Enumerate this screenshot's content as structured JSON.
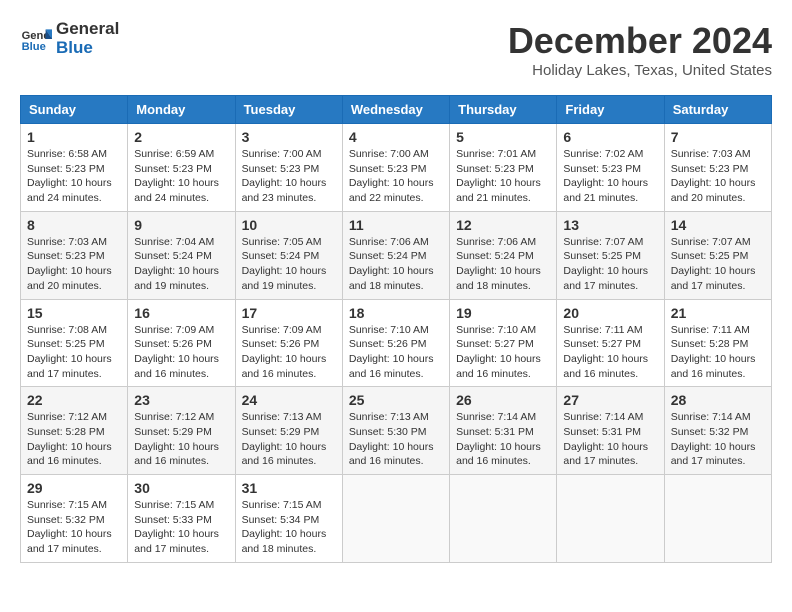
{
  "logo": {
    "line1": "General",
    "line2": "Blue"
  },
  "title": "December 2024",
  "location": "Holiday Lakes, Texas, United States",
  "days_of_week": [
    "Sunday",
    "Monday",
    "Tuesday",
    "Wednesday",
    "Thursday",
    "Friday",
    "Saturday"
  ],
  "weeks": [
    [
      {
        "day": "1",
        "sunrise": "6:58 AM",
        "sunset": "5:23 PM",
        "daylight": "10 hours and 24 minutes."
      },
      {
        "day": "2",
        "sunrise": "6:59 AM",
        "sunset": "5:23 PM",
        "daylight": "10 hours and 24 minutes."
      },
      {
        "day": "3",
        "sunrise": "7:00 AM",
        "sunset": "5:23 PM",
        "daylight": "10 hours and 23 minutes."
      },
      {
        "day": "4",
        "sunrise": "7:00 AM",
        "sunset": "5:23 PM",
        "daylight": "10 hours and 22 minutes."
      },
      {
        "day": "5",
        "sunrise": "7:01 AM",
        "sunset": "5:23 PM",
        "daylight": "10 hours and 21 minutes."
      },
      {
        "day": "6",
        "sunrise": "7:02 AM",
        "sunset": "5:23 PM",
        "daylight": "10 hours and 21 minutes."
      },
      {
        "day": "7",
        "sunrise": "7:03 AM",
        "sunset": "5:23 PM",
        "daylight": "10 hours and 20 minutes."
      }
    ],
    [
      {
        "day": "8",
        "sunrise": "7:03 AM",
        "sunset": "5:23 PM",
        "daylight": "10 hours and 20 minutes."
      },
      {
        "day": "9",
        "sunrise": "7:04 AM",
        "sunset": "5:24 PM",
        "daylight": "10 hours and 19 minutes."
      },
      {
        "day": "10",
        "sunrise": "7:05 AM",
        "sunset": "5:24 PM",
        "daylight": "10 hours and 19 minutes."
      },
      {
        "day": "11",
        "sunrise": "7:06 AM",
        "sunset": "5:24 PM",
        "daylight": "10 hours and 18 minutes."
      },
      {
        "day": "12",
        "sunrise": "7:06 AM",
        "sunset": "5:24 PM",
        "daylight": "10 hours and 18 minutes."
      },
      {
        "day": "13",
        "sunrise": "7:07 AM",
        "sunset": "5:25 PM",
        "daylight": "10 hours and 17 minutes."
      },
      {
        "day": "14",
        "sunrise": "7:07 AM",
        "sunset": "5:25 PM",
        "daylight": "10 hours and 17 minutes."
      }
    ],
    [
      {
        "day": "15",
        "sunrise": "7:08 AM",
        "sunset": "5:25 PM",
        "daylight": "10 hours and 17 minutes."
      },
      {
        "day": "16",
        "sunrise": "7:09 AM",
        "sunset": "5:26 PM",
        "daylight": "10 hours and 16 minutes."
      },
      {
        "day": "17",
        "sunrise": "7:09 AM",
        "sunset": "5:26 PM",
        "daylight": "10 hours and 16 minutes."
      },
      {
        "day": "18",
        "sunrise": "7:10 AM",
        "sunset": "5:26 PM",
        "daylight": "10 hours and 16 minutes."
      },
      {
        "day": "19",
        "sunrise": "7:10 AM",
        "sunset": "5:27 PM",
        "daylight": "10 hours and 16 minutes."
      },
      {
        "day": "20",
        "sunrise": "7:11 AM",
        "sunset": "5:27 PM",
        "daylight": "10 hours and 16 minutes."
      },
      {
        "day": "21",
        "sunrise": "7:11 AM",
        "sunset": "5:28 PM",
        "daylight": "10 hours and 16 minutes."
      }
    ],
    [
      {
        "day": "22",
        "sunrise": "7:12 AM",
        "sunset": "5:28 PM",
        "daylight": "10 hours and 16 minutes."
      },
      {
        "day": "23",
        "sunrise": "7:12 AM",
        "sunset": "5:29 PM",
        "daylight": "10 hours and 16 minutes."
      },
      {
        "day": "24",
        "sunrise": "7:13 AM",
        "sunset": "5:29 PM",
        "daylight": "10 hours and 16 minutes."
      },
      {
        "day": "25",
        "sunrise": "7:13 AM",
        "sunset": "5:30 PM",
        "daylight": "10 hours and 16 minutes."
      },
      {
        "day": "26",
        "sunrise": "7:14 AM",
        "sunset": "5:31 PM",
        "daylight": "10 hours and 16 minutes."
      },
      {
        "day": "27",
        "sunrise": "7:14 AM",
        "sunset": "5:31 PM",
        "daylight": "10 hours and 17 minutes."
      },
      {
        "day": "28",
        "sunrise": "7:14 AM",
        "sunset": "5:32 PM",
        "daylight": "10 hours and 17 minutes."
      }
    ],
    [
      {
        "day": "29",
        "sunrise": "7:15 AM",
        "sunset": "5:32 PM",
        "daylight": "10 hours and 17 minutes."
      },
      {
        "day": "30",
        "sunrise": "7:15 AM",
        "sunset": "5:33 PM",
        "daylight": "10 hours and 17 minutes."
      },
      {
        "day": "31",
        "sunrise": "7:15 AM",
        "sunset": "5:34 PM",
        "daylight": "10 hours and 18 minutes."
      },
      null,
      null,
      null,
      null
    ]
  ]
}
